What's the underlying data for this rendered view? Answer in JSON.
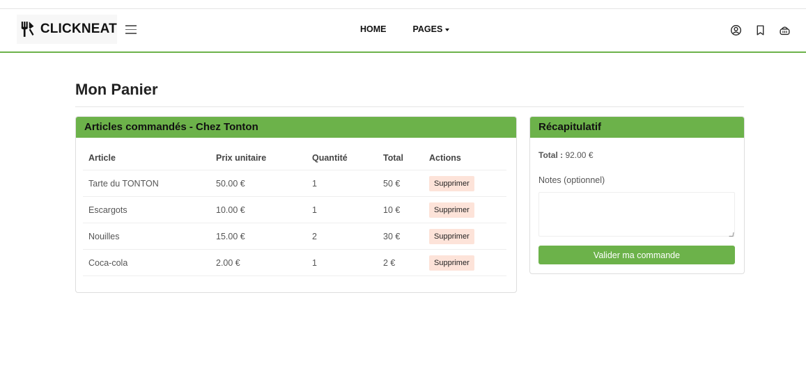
{
  "header": {
    "brand": "CLICKNEAT",
    "brand_icon": "fork-knife-icon",
    "nav": [
      {
        "label": "HOME"
      },
      {
        "label": "PAGES"
      }
    ],
    "icons": [
      "user-icon",
      "bookmark-icon",
      "basket-icon"
    ],
    "accent_color": "#6cb24a"
  },
  "page": {
    "title": "Mon Panier"
  },
  "cart": {
    "header": "Articles commandés - Chez Tonton",
    "columns": [
      "Article",
      "Prix unitaire",
      "Quantité",
      "Total",
      "Actions"
    ],
    "rows": [
      {
        "article": "Tarte du TONTON",
        "price": "50.00 €",
        "qty": "1",
        "total": "50 €",
        "action": "Supprimer"
      },
      {
        "article": "Escargots",
        "price": "10.00 €",
        "qty": "1",
        "total": "10 €",
        "action": "Supprimer"
      },
      {
        "article": "Nouilles",
        "price": "15.00 €",
        "qty": "2",
        "total": "30 €",
        "action": "Supprimer"
      },
      {
        "article": "Coca-cola",
        "price": "2.00 €",
        "qty": "1",
        "total": "2 €",
        "action": "Supprimer"
      }
    ]
  },
  "summary": {
    "header": "Récapitulatif",
    "total_label": "Total :",
    "total_value": "92.00 €",
    "notes_label": "Notes (optionnel)",
    "notes_value": "",
    "submit_label": "Valider ma commande"
  }
}
